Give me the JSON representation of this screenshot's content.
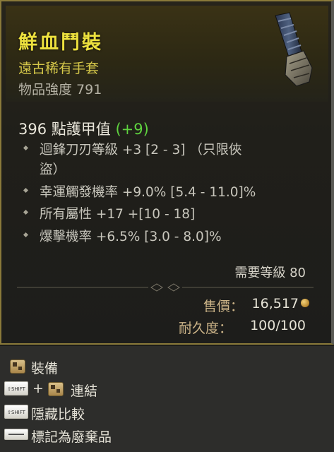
{
  "item": {
    "name": "鮮血鬥裝",
    "rarity_type": "遠古稀有手套",
    "item_power": "物品強度 791",
    "armor_text": "396 點護甲值",
    "armor_bonus": "(+9)",
    "affixes": [
      "迴鋒刀刃等級 +3 [2 - 3] （只限俠",
      "盜）",
      "幸運觸發機率 +9.0% [5.4 - 11.0]%",
      "所有屬性 +17 +[10 - 18]",
      "爆擊機率 +6.5% [3.0 - 8.0]%"
    ],
    "required_level": "需要等級 80",
    "price_label": "售價：",
    "price_value": "16,517",
    "durability_label": "耐久度：",
    "durability_value": "100/100"
  },
  "actions": {
    "equip": "裝備",
    "shift_key": "⇧SHIFT",
    "plus": "+",
    "link": "連結",
    "hide_compare": "隱藏比較",
    "mark_junk": "標記為廢棄品"
  },
  "colors": {
    "title": "#ede13e",
    "rarity": "#d6c84a",
    "bonus": "#5fd33f",
    "label_gold": "#ccb488"
  }
}
